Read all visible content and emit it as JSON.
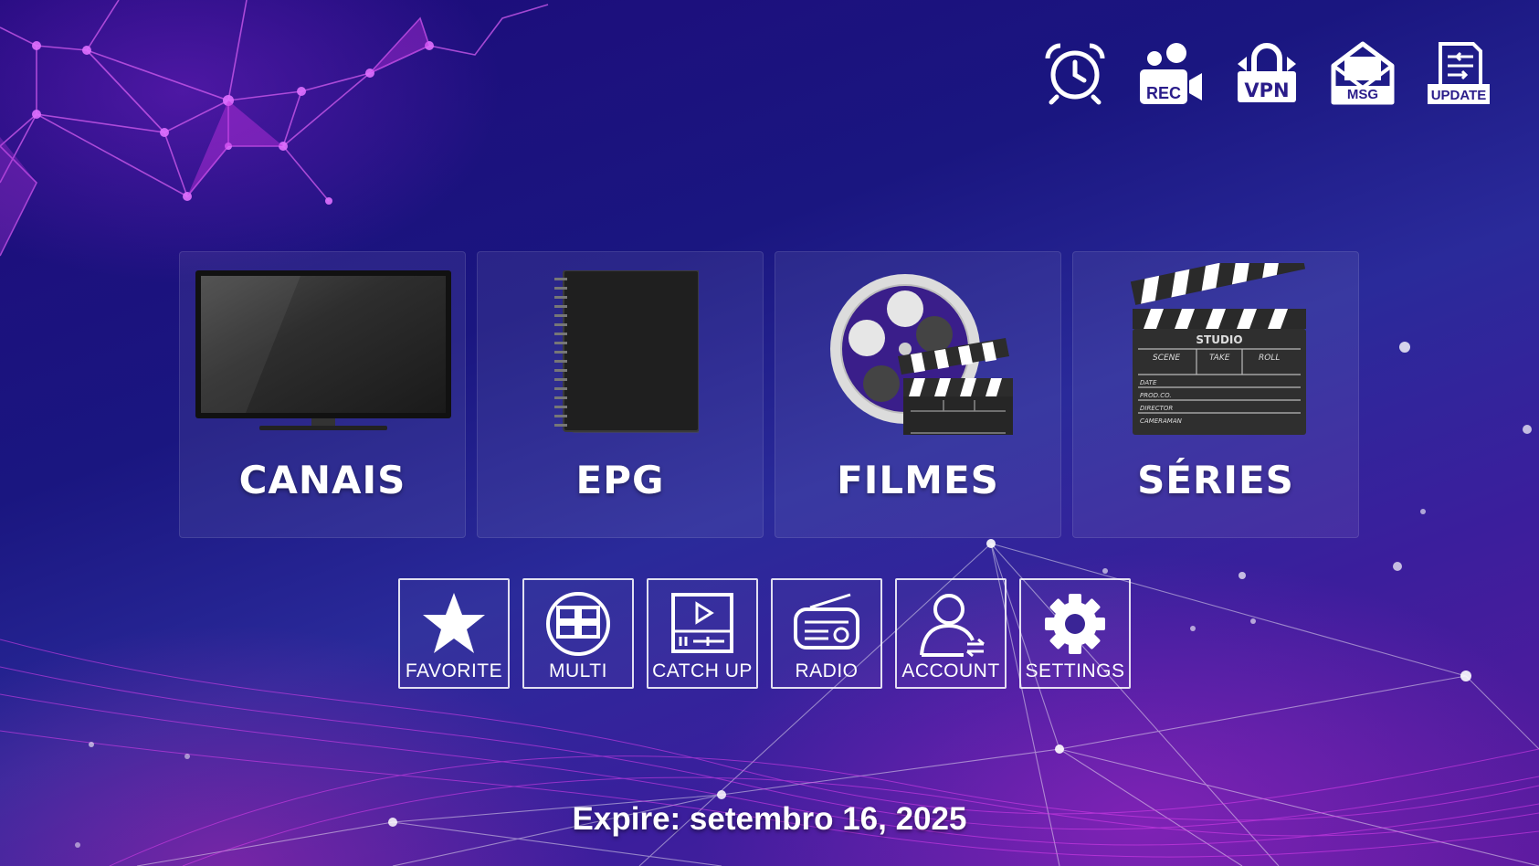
{
  "top_bar": {
    "items": [
      {
        "icon": "alarm-clock-icon",
        "label": ""
      },
      {
        "icon": "rec-icon",
        "label": "REC"
      },
      {
        "icon": "vpn-icon",
        "label": "VPN"
      },
      {
        "icon": "msg-icon",
        "label": "MSG"
      },
      {
        "icon": "update-icon",
        "label": "UPDATE"
      }
    ]
  },
  "main_tiles": [
    {
      "icon": "tv-icon",
      "label": "CANAIS"
    },
    {
      "icon": "notebook-icon",
      "label": "EPG"
    },
    {
      "icon": "film-reel-icon",
      "label": "FILMES"
    },
    {
      "icon": "clapperboard-icon",
      "label": "SÉRIES"
    }
  ],
  "clapper_text": {
    "studio": "STUDIO",
    "scene": "SCENE",
    "take": "TAKE",
    "roll": "ROLL",
    "date": "DATE",
    "prod": "PROD.CO.",
    "director": "DIRECTOR",
    "cameraman": "CAMERAMAN"
  },
  "shortcuts": [
    {
      "icon": "star-icon",
      "label": "FAVORITE"
    },
    {
      "icon": "multi-screen-icon",
      "label": "MULTI"
    },
    {
      "icon": "catch-up-icon",
      "label": "CATCH UP"
    },
    {
      "icon": "radio-icon",
      "label": "RADIO"
    },
    {
      "icon": "account-icon",
      "label": "ACCOUNT"
    },
    {
      "icon": "gear-icon",
      "label": "SETTINGS"
    }
  ],
  "expire_text": "Expire: setembro 16, 2025",
  "colors": {
    "accent": "#c02ad8",
    "background": "#1e1580"
  }
}
